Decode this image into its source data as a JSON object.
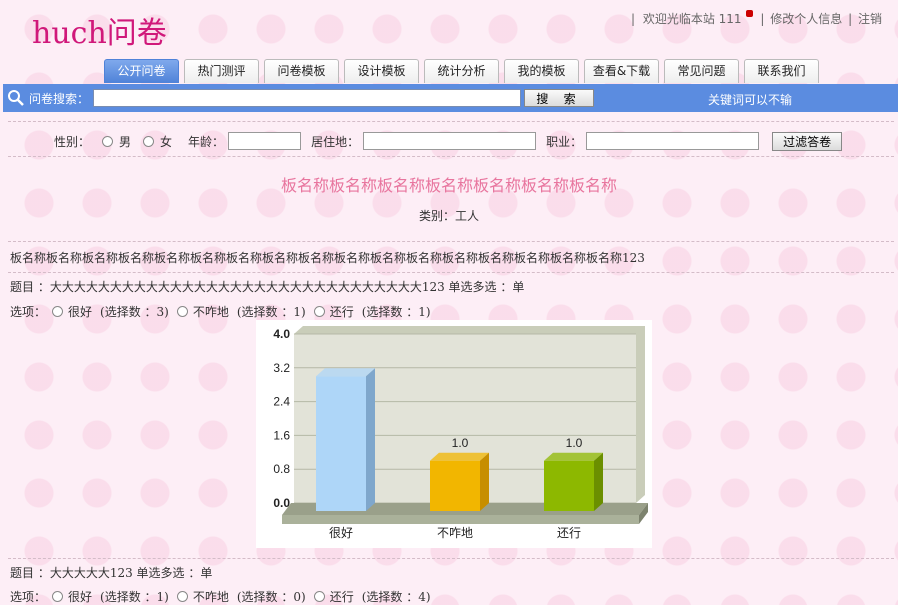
{
  "header": {
    "brand": "huch问卷",
    "welcome": "欢迎光临本站 111",
    "edit_profile": "修改个人信息",
    "logout": "注销"
  },
  "tabs": [
    {
      "label": "公开问卷",
      "active": true
    },
    {
      "label": "热门测评"
    },
    {
      "label": "问卷模板"
    },
    {
      "label": "设计模板"
    },
    {
      "label": "统计分析"
    },
    {
      "label": "我的模板"
    },
    {
      "label": "查看&下载"
    },
    {
      "label": "常见问题"
    },
    {
      "label": "联系我们"
    }
  ],
  "search": {
    "label": "问卷搜索：",
    "value": "",
    "button": "搜 索",
    "hint": "关键词可以不输"
  },
  "filter": {
    "gender_label": "性别：",
    "male": "男",
    "female": "女",
    "age_label": "年龄：",
    "residence_label": "居住地：",
    "job_label": "职业：",
    "button": "过滤答卷"
  },
  "survey": {
    "title": "板名称板名称板名称板名称板名称板名称板名称",
    "category": "类别：工人",
    "description": "板名称板名称板名称板名称板名称板名称板名称板名称板名称板名称板名称板名称板名称板名称板名称板名称板名称123"
  },
  "questions": [
    {
      "title": "题目 ：大大大大大大大大大大大大大大大大大大大大大大大大大大大大大大大123 单选多选 ：单",
      "options_label": "选项：",
      "options": [
        {
          "label": "很好",
          "count": "(选择数 ：3)"
        },
        {
          "label": "不咋地",
          "count": "(选择数 ：1)"
        },
        {
          "label": "还行",
          "count": "(选择数 ：1)"
        }
      ]
    },
    {
      "title": "题目 ：大大大大大123 单选多选 ：单",
      "options_label": "选项：",
      "options": [
        {
          "label": "很好",
          "count": "(选择数 ：1)"
        },
        {
          "label": "不咋地",
          "count": "(选择数 ：0)"
        },
        {
          "label": "还行",
          "count": "(选择数 ：4)"
        }
      ]
    }
  ],
  "chart_data": {
    "type": "bar",
    "categories": [
      "很好",
      "不咋地",
      "还行"
    ],
    "values": [
      3.0,
      1.0,
      1.0
    ],
    "value_labels": [
      "",
      "1.0",
      "1.0"
    ],
    "yticks": [
      "0.0",
      "0.8",
      "1.6",
      "2.4",
      "3.2",
      "4.0"
    ],
    "ylim": [
      0,
      4
    ],
    "colors": [
      "#aed6f8",
      "#f2b600",
      "#8db800"
    ],
    "side_colors": [
      "#7fa7cc",
      "#c78e00",
      "#6b8f00"
    ],
    "grid": true,
    "style": "3d"
  }
}
